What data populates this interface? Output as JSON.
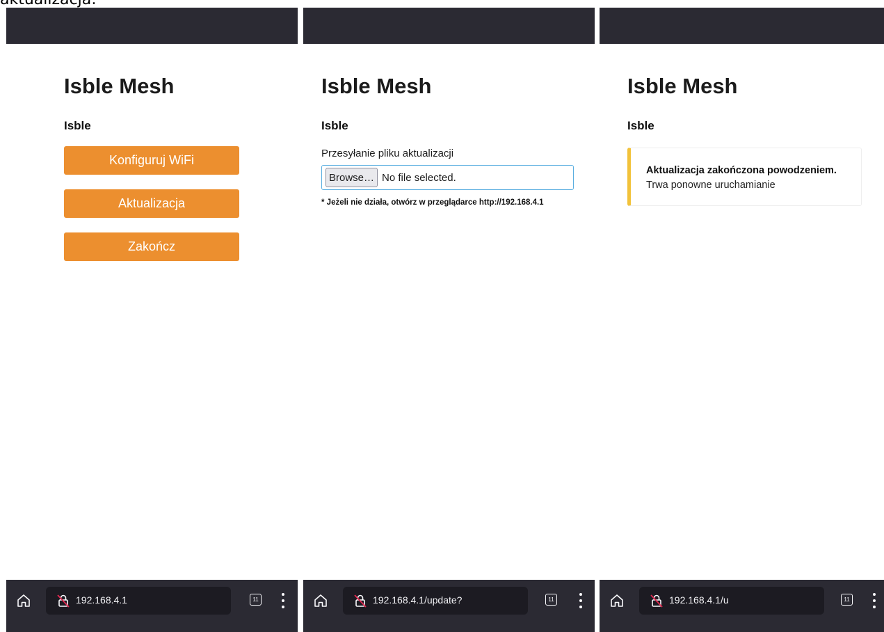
{
  "caption": "aktualizacja:",
  "screens": [
    {
      "heading": "Isble Mesh",
      "subheading": "Isble",
      "buttons": [
        "Konfiguruj WiFi",
        "Aktualizacja",
        "Zakończ"
      ],
      "url": "192.168.4.1",
      "tab_count": "11"
    },
    {
      "heading": "Isble Mesh",
      "subheading": "Isble",
      "upload_label": "Przesyłanie pliku aktualizacji",
      "browse_label": "Browse…",
      "file_status": "No file selected.",
      "note": "* Jeżeli nie działa, otwórz w przeglądarce http://192.168.4.1",
      "url": "192.168.4.1/update?",
      "tab_count": "11"
    },
    {
      "heading": "Isble Mesh",
      "subheading": "Isble",
      "alert_title": "Aktualizacja zakończona powodzeniem.",
      "alert_text": "Trwa ponowne uruchamianie",
      "url": "192.168.4.1/u",
      "tab_count": "11"
    }
  ],
  "icons": {
    "home": "home-icon",
    "lock": "insecure-lock-icon",
    "tabs": "tabs-counter-icon",
    "menu": "kebab-menu-icon"
  },
  "colors": {
    "toolbar": "#2b2a33",
    "urlbar": "#1c1b22",
    "button": "#ec8f2f",
    "alert_accent": "#f2c23a",
    "input_border": "#5aaee0"
  }
}
